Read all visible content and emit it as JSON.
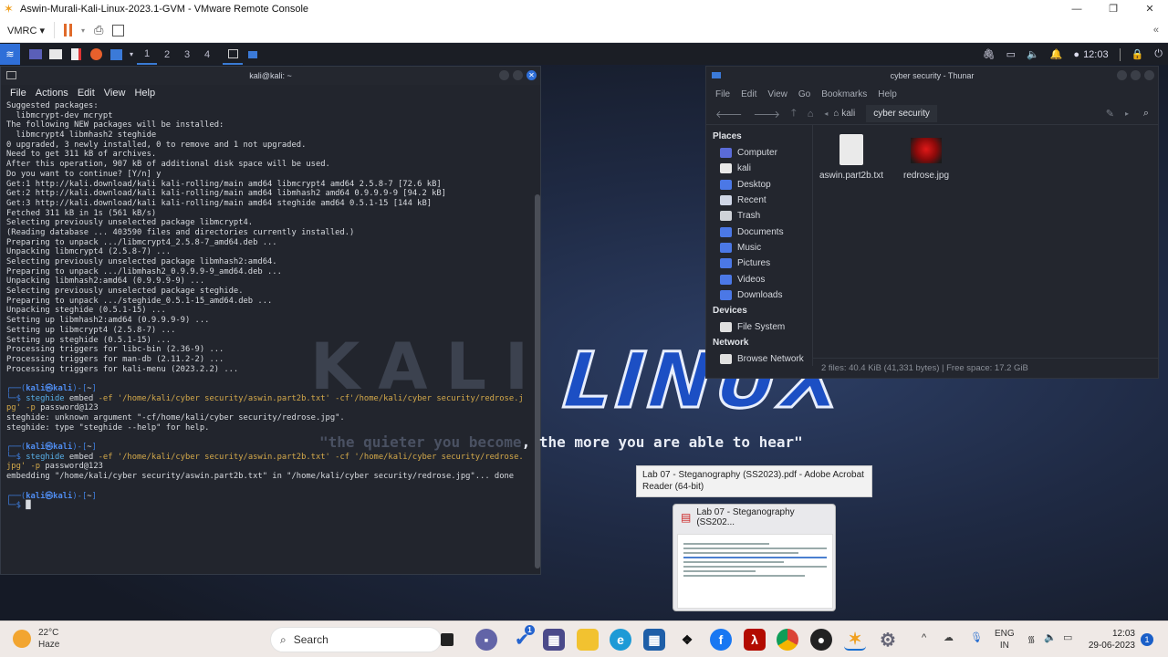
{
  "window": {
    "title": "Aswin-Murali-Kali-Linux-2023.1-GVM - VMware Remote Console",
    "minimize": "—",
    "maximize": "❐",
    "close": "✕"
  },
  "vmrc": {
    "menu_label": "VMRC ▾",
    "pause_icon": "pause",
    "send_icon": "send-keys",
    "fullscreen_icon": "fullscreen"
  },
  "kali_panel": {
    "workspaces": [
      "1",
      "2",
      "3",
      "4"
    ],
    "clock": "12:03"
  },
  "desktop": {
    "logo": "LINUX",
    "logo_ghost": "KALI",
    "quote_dim": "\"the quieter you become",
    "quote": ", the more you are able to hear\""
  },
  "terminal": {
    "title": "kali@kali: ~",
    "menu": [
      "File",
      "Actions",
      "Edit",
      "View",
      "Help"
    ],
    "lines": [
      "Suggested packages:",
      "  libmcrypt-dev mcrypt",
      "The following NEW packages will be installed:",
      "  libmcrypt4 libmhash2 steghide",
      "0 upgraded, 3 newly installed, 0 to remove and 1 not upgraded.",
      "Need to get 311 kB of archives.",
      "After this operation, 907 kB of additional disk space will be used.",
      "Do you want to continue? [Y/n] y",
      "Get:1 http://kali.download/kali kali-rolling/main amd64 libmcrypt4 amd64 2.5.8-7 [72.6 kB]",
      "Get:2 http://kali.download/kali kali-rolling/main amd64 libmhash2 amd64 0.9.9.9-9 [94.2 kB]",
      "Get:3 http://kali.download/kali kali-rolling/main amd64 steghide amd64 0.5.1-15 [144 kB]",
      "Fetched 311 kB in 1s (561 kB/s)",
      "Selecting previously unselected package libmcrypt4.",
      "(Reading database ... 403590 files and directories currently installed.)",
      "Preparing to unpack .../libmcrypt4_2.5.8-7_amd64.deb ...",
      "Unpacking libmcrypt4 (2.5.8-7) ...",
      "Selecting previously unselected package libmhash2:amd64.",
      "Preparing to unpack .../libmhash2_0.9.9.9-9_amd64.deb ...",
      "Unpacking libmhash2:amd64 (0.9.9.9-9) ...",
      "Selecting previously unselected package steghide.",
      "Preparing to unpack .../steghide_0.5.1-15_amd64.deb ...",
      "Unpacking steghide (0.5.1-15) ...",
      "Setting up libmhash2:amd64 (0.9.9.9-9) ...",
      "Setting up libmcrypt4 (2.5.8-7) ...",
      "Setting up steghide (0.5.1-15) ...",
      "Processing triggers for libc-bin (2.36-9) ...",
      "Processing triggers for man-db (2.11.2-2) ...",
      "Processing triggers for kali-menu (2023.2.2) ...",
      "",
      [
        {
          "t": "┌──(",
          "c": "p"
        },
        {
          "t": "kali㉿kali",
          "c": "u"
        },
        {
          "t": ")-[",
          "c": "p"
        },
        {
          "t": "~",
          "c": ""
        },
        {
          "t": "]",
          "c": "p"
        }
      ],
      [
        {
          "t": "└─$ ",
          "c": "p"
        },
        {
          "t": "steghide",
          "c": "cmd"
        },
        {
          "t": " embed ",
          "c": ""
        },
        {
          "t": "-ef '/home/kali/cyber security/aswin.part2b.txt' -cf'/home/kali/cyber security/redrose.j",
          "c": "arg"
        }
      ],
      [
        {
          "t": "pg'",
          "c": "arg"
        },
        {
          "t": " -p ",
          "c": "arg"
        },
        {
          "t": "password@123",
          "c": ""
        }
      ],
      "steghide: unknown argument \"-cf/home/kali/cyber security/redrose.jpg\".",
      "steghide: type \"steghide --help\" for help.",
      "",
      [
        {
          "t": "┌──(",
          "c": "p"
        },
        {
          "t": "kali㉿kali",
          "c": "u"
        },
        {
          "t": ")-[",
          "c": "p"
        },
        {
          "t": "~",
          "c": ""
        },
        {
          "t": "]",
          "c": "p"
        }
      ],
      [
        {
          "t": "└─$ ",
          "c": "p"
        },
        {
          "t": "steghide",
          "c": "cmd"
        },
        {
          "t": " embed ",
          "c": ""
        },
        {
          "t": "-ef '/home/kali/cyber security/aswin.part2b.txt' -cf '/home/kali/cyber security/redrose.",
          "c": "arg"
        }
      ],
      [
        {
          "t": "jpg'",
          "c": "arg"
        },
        {
          "t": " -p ",
          "c": "arg"
        },
        {
          "t": "password@123",
          "c": ""
        }
      ],
      "embedding \"/home/kali/cyber security/aswin.part2b.txt\" in \"/home/kali/cyber security/redrose.jpg\"... done",
      "",
      [
        {
          "t": "┌──(",
          "c": "p"
        },
        {
          "t": "kali㉿kali",
          "c": "u"
        },
        {
          "t": ")-[",
          "c": "p"
        },
        {
          "t": "~",
          "c": ""
        },
        {
          "t": "]",
          "c": "p"
        }
      ],
      [
        {
          "t": "└─$ ",
          "c": "p"
        },
        {
          "t": "█",
          "c": ""
        }
      ]
    ]
  },
  "thunar": {
    "title": "cyber security - Thunar",
    "menu": [
      "File",
      "Edit",
      "View",
      "Go",
      "Bookmarks",
      "Help"
    ],
    "path": [
      "kali",
      "cyber security"
    ],
    "sections": [
      {
        "heading": "Places",
        "items": [
          {
            "label": "Computer",
            "color": "#5a6bd8"
          },
          {
            "label": "kali",
            "color": "#e8e8e8"
          },
          {
            "label": "Desktop",
            "color": "#4b78e6"
          },
          {
            "label": "Recent",
            "color": "#cfd6e6"
          },
          {
            "label": "Trash",
            "color": "#cfd2d8"
          },
          {
            "label": "Documents",
            "color": "#4b78e6"
          },
          {
            "label": "Music",
            "color": "#4b78e6"
          },
          {
            "label": "Pictures",
            "color": "#4b78e6"
          },
          {
            "label": "Videos",
            "color": "#4b78e6"
          },
          {
            "label": "Downloads",
            "color": "#4b78e6"
          }
        ]
      },
      {
        "heading": "Devices",
        "items": [
          {
            "label": "File System",
            "color": "#e0e0e0"
          }
        ]
      },
      {
        "heading": "Network",
        "items": [
          {
            "label": "Browse Network",
            "color": "#e0e0e0"
          }
        ]
      }
    ],
    "files": [
      {
        "name": "aswin.part2b.txt",
        "type": "text"
      },
      {
        "name": "redrose.jpg",
        "type": "image"
      }
    ],
    "status": "2 files: 40.4 KiB (41,331 bytes) | Free space: 17.2 GiB"
  },
  "tooltip": {
    "text": "Lab 07 - Steganography (SS2023).pdf - Adobe Acrobat Reader (64-bit)"
  },
  "preview": {
    "title": "Lab 07 - Steganography (SS202..."
  },
  "taskbar": {
    "weather_temp": "22°C",
    "weather_desc": "Haze",
    "search": "Search",
    "lang1": "ENG",
    "lang2": "IN",
    "time": "12:03",
    "date": "29-06-2023",
    "notif_count": "1",
    "todo_badge": "1"
  }
}
